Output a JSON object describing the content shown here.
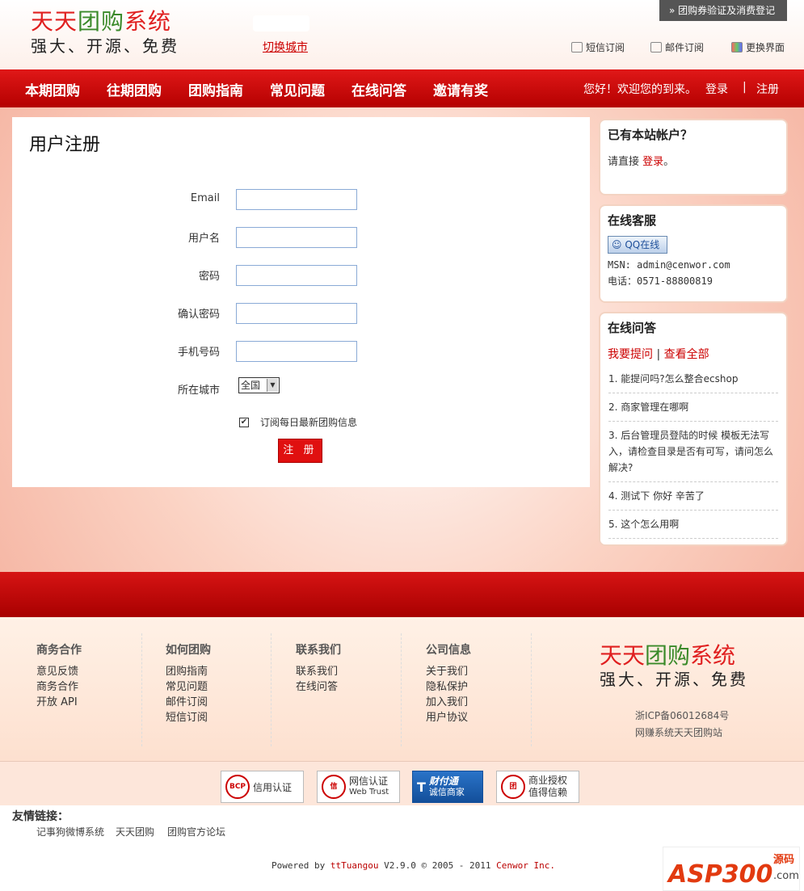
{
  "header": {
    "logo_title": "天天团购系统",
    "logo_part1": "天天",
    "logo_part2": "团购",
    "logo_part3": "系统",
    "slogan": "强大、开源、免费",
    "switch_city": "切换城市",
    "verify": "» 团购券验证及消费登记",
    "sms": "短信订阅",
    "mail": "邮件订阅",
    "theme": "更换界面"
  },
  "nav": {
    "items": [
      "本期团购",
      "往期团购",
      "团购指南",
      "常见问题",
      "在线问答",
      "邀请有奖"
    ],
    "welcome": "您好！欢迎您的到来。",
    "login": "登录",
    "sep": "|",
    "register": "注册"
  },
  "form": {
    "title": "用户注册",
    "email_label": "Email",
    "username_label": "用户名",
    "password_label": "密码",
    "confirm_label": "确认密码",
    "phone_label": "手机号码",
    "city_label": "所在城市",
    "city_value": "全国",
    "subscribe_label": "订阅每日最新团购信息",
    "submit": "注 册"
  },
  "sidebar": {
    "account_title": "已有本站帐户？",
    "account_text": "请直接",
    "account_link": "登录",
    "account_end": "。",
    "service_title": "在线客服",
    "qq_label": "QQ在线",
    "msn": "MSN: admin@cenwor.com",
    "phone": "电话：0571-88800819",
    "qa_title": "在线问答",
    "ask": "我要提问",
    "sep": "|",
    "view_all": "查看全部",
    "questions": [
      "1. 能提问吗?怎么整合ecshop",
      "2. 商家管理在哪啊",
      "3. 后台管理员登陆的时候 模板无法写入，请检查目录是否有可写，请问怎么解决?",
      "4. 测试下 你好 辛苦了",
      "5. 这个怎么用啊"
    ]
  },
  "footer": {
    "cols": [
      {
        "title": "商务合作",
        "items": [
          "意见反馈",
          "商务合作",
          "开放 API"
        ]
      },
      {
        "title": "如何团购",
        "items": [
          "团购指南",
          "常见问题",
          "邮件订阅",
          "短信订阅"
        ]
      },
      {
        "title": "联系我们",
        "items": [
          "联系我们",
          "在线问答"
        ]
      },
      {
        "title": "公司信息",
        "items": [
          "关于我们",
          "隐私保护",
          "加入我们",
          "用户协议"
        ]
      }
    ],
    "icp": "浙ICP备06012684号",
    "site": "网赚系统天天团购站"
  },
  "badges": {
    "b1": "信用认证",
    "b1_seal": "BCP",
    "b2_line1": "网信认证",
    "b2_line2": "Web Trust",
    "b2_seal": "信",
    "b3_line1": "财付通",
    "b3_line2": "诚信商家",
    "b4_line1": "商业授权",
    "b4_line2": "值得信赖",
    "b4_seal": "团"
  },
  "links": {
    "title": "友情链接：",
    "items": [
      "记事狗微博系统",
      "天天团购",
      "团购官方论坛"
    ],
    "powered_prefix": "Powered by",
    "powered_name": "ttTuangou",
    "powered_mid": "V2.9.0 © 2005 - 2011",
    "powered_company": "Cenwor Inc."
  },
  "watermark": {
    "main": "ASP300",
    "side1": "源码",
    "side2": ".com"
  },
  "colors": {
    "brand_red": "#d61414",
    "accent_green": "#3a8a2a"
  }
}
